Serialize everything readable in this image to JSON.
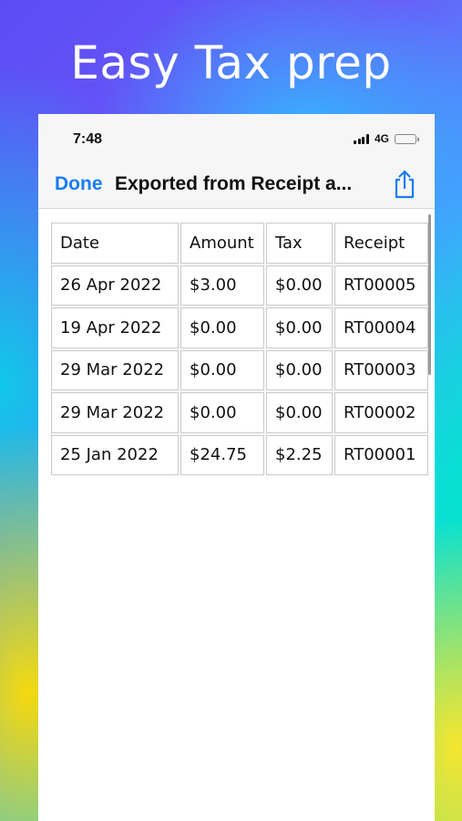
{
  "hero": {
    "title": "Easy Tax prep"
  },
  "status_bar": {
    "time": "7:48",
    "network": "4G"
  },
  "nav": {
    "done_label": "Done",
    "title": "Exported from Receipt a...",
    "share_icon": "share-icon"
  },
  "table": {
    "headers": {
      "date": "Date",
      "amount": "Amount",
      "tax": "Tax",
      "receipt": "Receipt"
    },
    "rows": [
      {
        "date": "26 Apr 2022",
        "amount": "$3.00",
        "tax": "$0.00",
        "receipt": "RT00005"
      },
      {
        "date": "19 Apr 2022",
        "amount": "$0.00",
        "tax": "$0.00",
        "receipt": "RT00004"
      },
      {
        "date": "29 Mar 2022",
        "amount": "$0.00",
        "tax": "$0.00",
        "receipt": "RT00003"
      },
      {
        "date": "29 Mar 2022",
        "amount": "$0.00",
        "tax": "$0.00",
        "receipt": "RT00002"
      },
      {
        "date": "25 Jan 2022",
        "amount": "$24.75",
        "tax": "$2.25",
        "receipt": "RT00001"
      }
    ]
  },
  "colors": {
    "accent": "#1a7cf0"
  }
}
